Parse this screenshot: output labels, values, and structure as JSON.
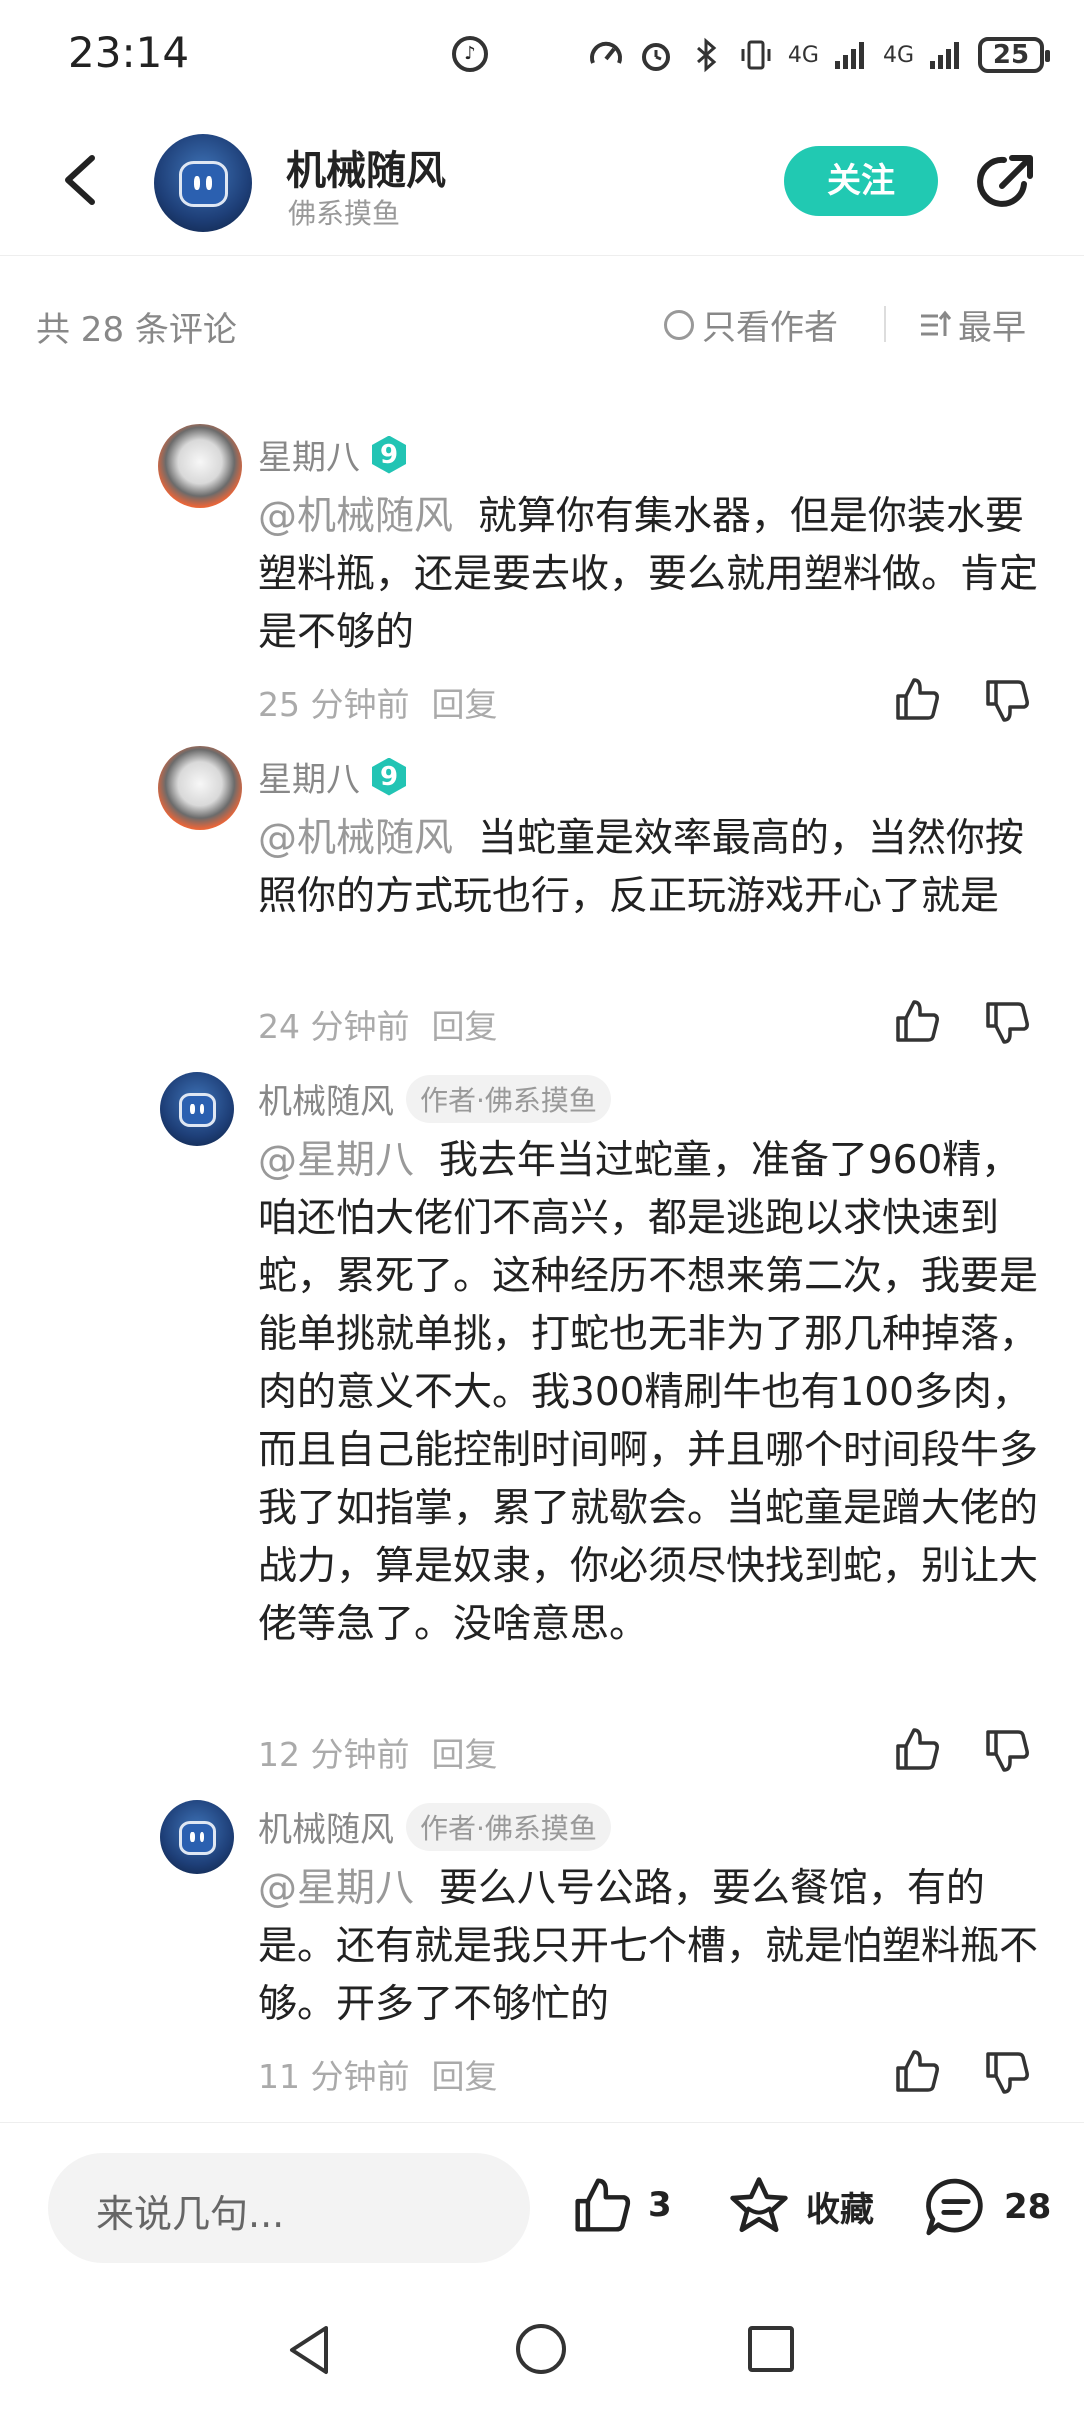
{
  "status_bar": {
    "time": "23:14",
    "network_1": "4G",
    "network_2": "4G",
    "battery": "25"
  },
  "header": {
    "name": "机械随风",
    "subtitle": "佛系摸鱼",
    "follow_label": "关注"
  },
  "sort_bar": {
    "comment_count": "共 28 条评论",
    "only_author": "只看作者",
    "sort_order": "最早"
  },
  "comments": [
    {
      "name": "星期八",
      "level": "9",
      "mention": "@机械随风",
      "text": "就算你有集水器，但是你装水要塑料瓶，还是要去收，要么就用塑料做。肯定是不够的",
      "time": "25 分钟前",
      "reply_label": "回复"
    },
    {
      "name": "星期八",
      "level": "9",
      "mention": "@机械随风",
      "text": "当蛇童是效率最高的，当然你按照你的方式玩也行，反正玩游戏开心了就是",
      "time": "24 分钟前",
      "reply_label": "回复"
    },
    {
      "name": "机械随风",
      "tag": "作者·佛系摸鱼",
      "mention": "@星期八",
      "text": "我去年当过蛇童，准备了960精，咱还怕大佬们不高兴，都是逃跑以求快速到蛇，累死了。这种经历不想来第二次，我要是能单挑就单挑，打蛇也无非为了那几种掉落，肉的意义不大。我300精刷牛也有100多肉，而且自己能控制时间啊，并且哪个时间段牛多我了如指掌，累了就歇会。当蛇童是蹭大佬的战力，算是奴隶，你必须尽快找到蛇，别让大佬等急了。没啥意思。",
      "time": "12 分钟前",
      "reply_label": "回复"
    },
    {
      "name": "机械随风",
      "tag": "作者·佛系摸鱼",
      "mention": "@星期八",
      "text": "要么八号公路，要么餐馆，有的是。还有就是我只开七个槽，就是怕塑料瓶不够。开多了不够忙的",
      "time": "11 分钟前",
      "reply_label": "回复"
    }
  ],
  "bottom_bar": {
    "input_placeholder": "来说几句...",
    "like_count": "3",
    "favorite_label": "收藏",
    "comment_count": "28"
  },
  "colors": {
    "accent": "#21c9b2",
    "text_primary": "#222222",
    "text_secondary": "#888888"
  }
}
